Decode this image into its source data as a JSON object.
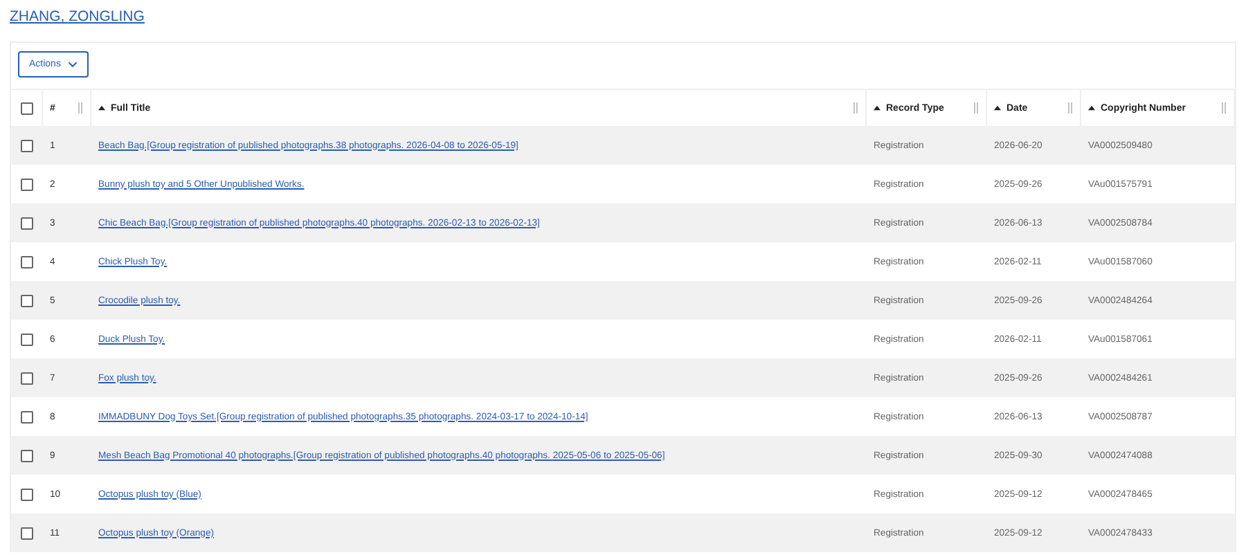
{
  "owner_link": "ZHANG, ZONGLING",
  "actions_button": "Actions",
  "table": {
    "select_all": {
      "checked": false
    },
    "columns": [
      {
        "label": "#",
        "sortable": false
      },
      {
        "label": "Full Title",
        "sortable": true
      },
      {
        "label": "Record Type",
        "sortable": true
      },
      {
        "label": "Date",
        "sortable": true
      },
      {
        "label": "Copyright Number",
        "sortable": true
      }
    ],
    "rows": [
      {
        "checked": false,
        "number": "1",
        "title": "Beach Bag.[Group registration of published photographs.38 photographs. 2026-04-08 to 2026-05-19]",
        "record_type": "Registration",
        "date": "2026-06-20",
        "copyright_number": "VA0002509480"
      },
      {
        "checked": false,
        "number": "2",
        "title": "Bunny plush toy and 5 Other Unpublished Works.",
        "record_type": "Registration",
        "date": "2025-09-26",
        "copyright_number": "VAu001575791"
      },
      {
        "checked": false,
        "number": "3",
        "title": "Chic Beach Bag.[Group registration of published photographs.40 photographs. 2026-02-13 to 2026-02-13]",
        "record_type": "Registration",
        "date": "2026-06-13",
        "copyright_number": "VA0002508784"
      },
      {
        "checked": false,
        "number": "4",
        "title": "Chick Plush Toy.",
        "record_type": "Registration",
        "date": "2026-02-11",
        "copyright_number": "VAu001587060"
      },
      {
        "checked": false,
        "number": "5",
        "title": "Crocodile plush toy.",
        "record_type": "Registration",
        "date": "2025-09-26",
        "copyright_number": "VA0002484264"
      },
      {
        "checked": false,
        "number": "6",
        "title": "Duck Plush Toy.",
        "record_type": "Registration",
        "date": "2026-02-11",
        "copyright_number": "VAu001587061"
      },
      {
        "checked": false,
        "number": "7",
        "title": "Fox plush toy.",
        "record_type": "Registration",
        "date": "2025-09-26",
        "copyright_number": "VA0002484261"
      },
      {
        "checked": false,
        "number": "8",
        "title": "IMMADBUNY Dog Toys Set.[Group registration of published photographs.35 photographs. 2024-03-17 to 2024-10-14]",
        "record_type": "Registration",
        "date": "2026-06-13",
        "copyright_number": "VA0002508787"
      },
      {
        "checked": false,
        "number": "9",
        "title": "Mesh Beach Bag Promotional 40 photographs.[Group registration of published photographs.40 photographs. 2025-05-06 to 2025-05-06]",
        "record_type": "Registration",
        "date": "2025-09-30",
        "copyright_number": "VA0002474088"
      },
      {
        "checked": false,
        "number": "10",
        "title": "Octopus plush toy (Blue)",
        "record_type": "Registration",
        "date": "2025-09-12",
        "copyright_number": "VA0002478465"
      },
      {
        "checked": false,
        "number": "11",
        "title": "Octopus plush toy (Orange)",
        "record_type": "Registration",
        "date": "2025-09-12",
        "copyright_number": "VA0002478433"
      }
    ]
  }
}
